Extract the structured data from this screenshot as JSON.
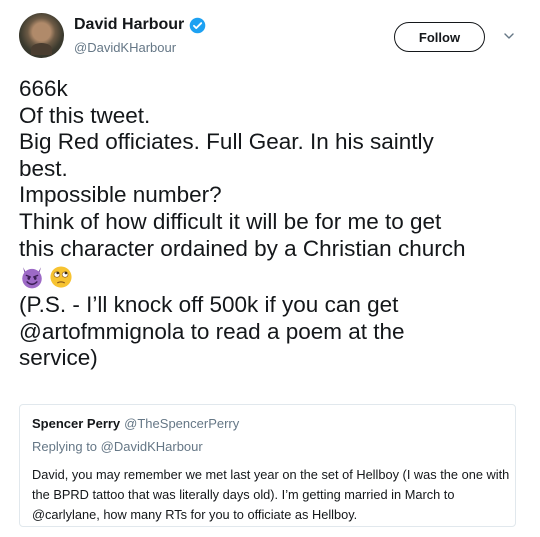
{
  "author": {
    "display_name": "David Harbour",
    "handle": "@DavidKHarbour",
    "verified": true
  },
  "follow_button": {
    "label": "Follow"
  },
  "tweet": {
    "lines": [
      "666k",
      "Of this tweet.",
      "Big Red officiates. Full Gear. In his saintly",
      "best.",
      "Impossible number?",
      "Think of how difficult it will be for me to get",
      "this character ordained by a Christian church"
    ],
    "emojis": [
      "smiling-imp-emoji",
      "face-with-rolling-eyes-emoji"
    ],
    "lines_after": [
      "(P.S. - I’ll knock off 500k if you can get",
      "@artofmmignola to read a poem at the",
      "service)"
    ]
  },
  "quoted_tweet": {
    "display_name": "Spencer Perry",
    "handle": "@TheSpencerPerry",
    "replying_to": "Replying to @DavidKHarbour",
    "lines": [
      "David, you may remember we met last year on the set of Hellboy (I was the one with",
      "the BPRD tattoo that was literally days old). I’m getting married in March to",
      "@carlylane, how many RTs for you to officiate as Hellboy."
    ]
  },
  "colors": {
    "text": "#14171a",
    "secondary": "#657786",
    "verified": "#1da1f2",
    "border": "#e1e8ed",
    "imp_purple": "#9d6ac6",
    "eyes_yellow": "#f7c331"
  }
}
